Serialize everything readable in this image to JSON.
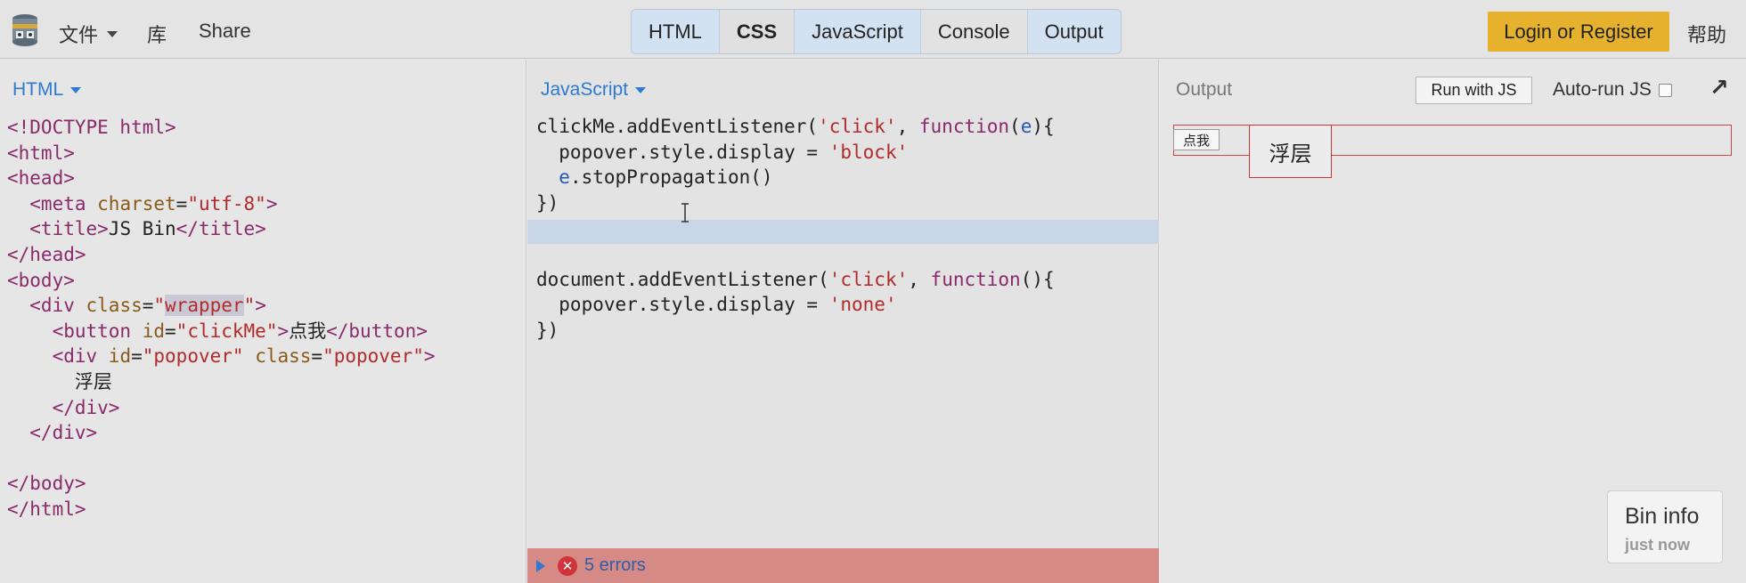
{
  "topbar": {
    "menu_file": "文件",
    "menu_library": "库",
    "menu_share": "Share",
    "tabs": [
      "HTML",
      "CSS",
      "JavaScript",
      "Console",
      "Output"
    ],
    "login": "Login or Register",
    "help": "帮助"
  },
  "html_panel": {
    "label": "HTML",
    "code": {
      "l1": "<!DOCTYPE html>",
      "l2": "<html>",
      "l3": "<head>",
      "l4a": "  <meta ",
      "l4b": "charset",
      "l4c": "=",
      "l4d": "\"utf-8\"",
      "l4e": ">",
      "l5a": "  <title>",
      "l5b": "JS Bin",
      "l5c": "</title>",
      "l6": "</head>",
      "l7": "<body>",
      "l8a": "  <div ",
      "l8b": "class",
      "l8c": "=",
      "l8d": "\"",
      "l8e": "wrapper",
      "l8f": "\"",
      "l8g": ">",
      "l9a": "    <button ",
      "l9b": "id",
      "l9c": "=",
      "l9d": "\"clickMe\"",
      "l9e": ">",
      "l9f": "点我",
      "l9g": "</button>",
      "l10a": "    <div ",
      "l10b": "id",
      "l10c": "=",
      "l10d": "\"popover\"",
      "l10e": " ",
      "l10f": "class",
      "l10g": "=",
      "l10h": "\"popover\"",
      "l10i": ">",
      "l11": "      浮层",
      "l12": "    </div>",
      "l13": "  </div>",
      "l14": "</body>",
      "l15": "</html>"
    }
  },
  "js_panel": {
    "label": "JavaScript",
    "code": {
      "a1a": "clickMe.addEventListener(",
      "a1b": "'click'",
      "a1c": ", ",
      "a1d": "function",
      "a1e": "(",
      "a1f": "e",
      "a1g": "){",
      "a2a": "  popover.style.display = ",
      "a2b": "'block'",
      "a3a": "  ",
      "a3b": "e",
      "a3c": ".stopPropagation()",
      "a4": "})",
      "b1a": "document.addEventListener(",
      "b1b": "'click'",
      "b1c": ", ",
      "b1d": "function",
      "b1e": "(){",
      "b2a": "  popover.style.display = ",
      "b2b": "'none'",
      "b3": "})"
    },
    "errors": "5 errors",
    "error_icon": "✕"
  },
  "output_panel": {
    "label": "Output",
    "run_with_js": "Run with JS",
    "auto_run": "Auto-run JS",
    "popout_icon": "↗",
    "button_text": "点我",
    "popover_text": "浮层"
  },
  "bin_info": {
    "title": "Bin info",
    "subtitle": "just now"
  }
}
